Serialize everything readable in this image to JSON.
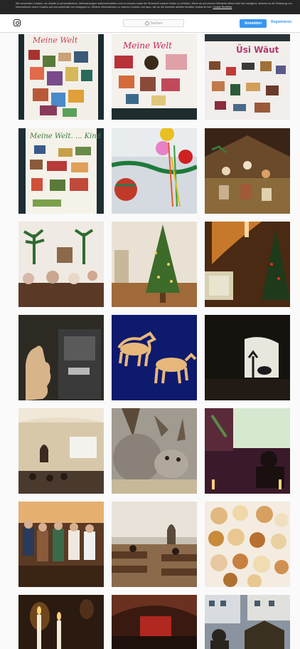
{
  "cookie_banner": {
    "text": "Wir verwenden Cookies, um Inhalte zu personalisieren, Werbeanzeigen maßzuschneidern und zu messen sowie die Sicherheit unserer Nutzer zu erhöhen. Wenn du auf unserer Webseite klickst oder hier navigierst, stimmst du der Erfassung von Informationen durch Cookies auf und außerhalb von Instagram zu. Weitere Informationen zu unseren Cookies und dazu, wie du die Kontrolle darüber behältst, findest du hier:",
    "link": "Cookie-Richtlinie"
  },
  "header": {
    "search_placeholder": "Suchen",
    "login_label": "Anmelden",
    "register_label": "Registrieren"
  },
  "posts": [
    {
      "caption": "Meine Welt",
      "bg": "#f3efe9",
      "accent": "#c84a5c"
    },
    {
      "caption": "Meine Welt",
      "bg": "#f4f0ec",
      "accent": "#c8285a"
    },
    {
      "caption": "Üsi Wäut",
      "bg": "#f2eeeb",
      "accent": "#b03c6e"
    },
    {
      "caption": "Meine Welt. ... Kind",
      "bg": "#f5f2ea",
      "accent": "#3c7a3c"
    },
    {
      "caption": "",
      "bg": "#cdd3da",
      "accent": "#2e7d32"
    },
    {
      "caption": "",
      "bg": "#3a2418",
      "accent": "#d9a066"
    },
    {
      "caption": "",
      "bg": "#efeae3",
      "accent": "#2f6b2f"
    },
    {
      "caption": "",
      "bg": "#e9e2d4",
      "accent": "#3d6b2a"
    },
    {
      "caption": "",
      "bg": "#4a2a12",
      "accent": "#e08a30"
    },
    {
      "caption": "",
      "bg": "#2d2a24",
      "accent": "#d8b48a"
    },
    {
      "caption": "",
      "bg": "#0d1a6e",
      "accent": "#e8b87a"
    },
    {
      "caption": "",
      "bg": "#16120e",
      "accent": "#e9e6de"
    },
    {
      "caption": "",
      "bg": "#4a3a2e",
      "accent": "#e8dcc6"
    },
    {
      "caption": "",
      "bg": "#a09a90",
      "accent": "#5b4a3a"
    },
    {
      "caption": "",
      "bg": "#3a1a2a",
      "accent": "#d7e8d0"
    },
    {
      "caption": "",
      "bg": "#5a3a24",
      "accent": "#e6b070"
    },
    {
      "caption": "",
      "bg": "#c8c0b4",
      "accent": "#5a3a24"
    },
    {
      "caption": "",
      "bg": "#f4ece0",
      "accent": "#c98a3a"
    },
    {
      "caption": "",
      "bg": "#2a1a10",
      "accent": "#ffd27a"
    },
    {
      "caption": "",
      "bg": "#3a1a10",
      "accent": "#b02820"
    },
    {
      "caption": "",
      "bg": "#8a94a0",
      "accent": "#3a3020"
    }
  ]
}
